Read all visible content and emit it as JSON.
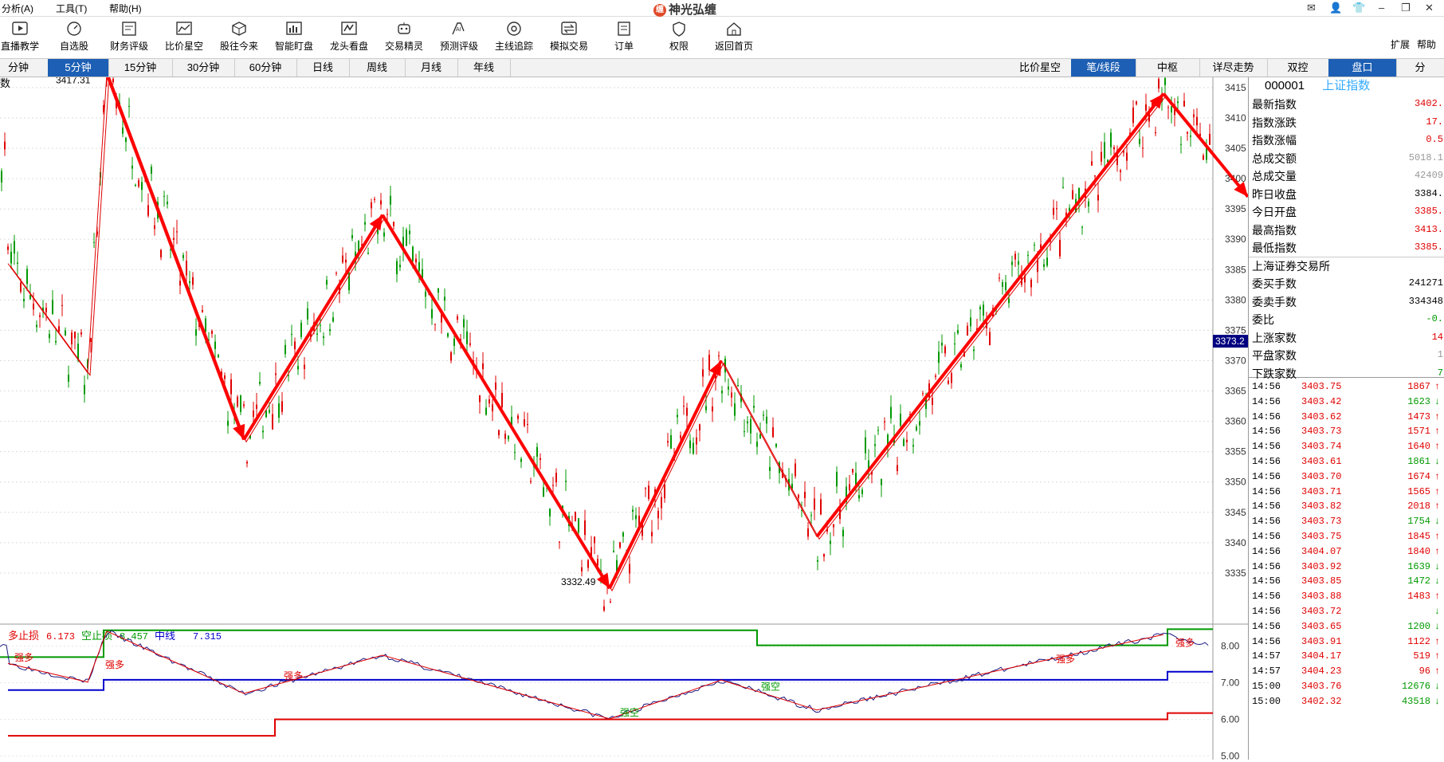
{
  "menu": [
    {
      "label": "分析(A)"
    },
    {
      "label": "工具(T)"
    },
    {
      "label": "帮助(H)"
    }
  ],
  "app_title": "神光弘缠",
  "toolbar": [
    {
      "label": "直播教学",
      "icon": "play-icon"
    },
    {
      "label": "自选股",
      "icon": "gauge-icon"
    },
    {
      "label": "财务评级",
      "icon": "finance-icon"
    },
    {
      "label": "比价星空",
      "icon": "line-chart-icon"
    },
    {
      "label": "股往今来",
      "icon": "cube-icon"
    },
    {
      "label": "智能盯盘",
      "icon": "bar-chart-icon"
    },
    {
      "label": "龙头看盘",
      "icon": "dragon-icon"
    },
    {
      "label": "交易精灵",
      "icon": "robot-icon"
    },
    {
      "label": "预测评级",
      "icon": "ai-icon"
    },
    {
      "label": "主线追踪",
      "icon": "target-icon"
    },
    {
      "label": "模拟交易",
      "icon": "exchange-icon"
    },
    {
      "label": "订单",
      "icon": "order-icon"
    },
    {
      "label": "权限",
      "icon": "shield-icon"
    },
    {
      "label": "返回首页",
      "icon": "home-icon"
    }
  ],
  "toolbar_right": [
    "扩展",
    "帮助"
  ],
  "period_tabs": [
    "分钟",
    "5分钟",
    "15分钟",
    "30分钟",
    "60分钟",
    "日线",
    "周线",
    "月线",
    "年线"
  ],
  "period_active": "5分钟",
  "right_tabs": [
    "比价星空",
    "笔/线段",
    "中枢",
    "详尽走势",
    "双控",
    "盘口",
    "分"
  ],
  "right_tabs_active": [
    "笔/线段",
    "盘口"
  ],
  "chart_label": "数",
  "indicator": {
    "items": [
      {
        "label": "多止损",
        "value": "6.173",
        "color": "#e00000"
      },
      {
        "label": "空止损",
        "value": "8.457",
        "color": "#009900"
      },
      {
        "label": "中线",
        "value": "7.315",
        "color": "#0000cc"
      }
    ],
    "axis": [
      "8.00",
      "7.00",
      "6.00",
      "5.00"
    ],
    "marks": [
      "强多",
      "强多",
      "强多",
      "强空",
      "强空",
      "强多",
      "强多"
    ]
  },
  "chart_data": {
    "type": "candlestick",
    "ylim": [
      3330,
      3418
    ],
    "yticks": [
      3415,
      3410,
      3405,
      3400,
      3395,
      3390,
      3385,
      3380,
      3375,
      3370,
      3365,
      3360,
      3355,
      3350,
      3345,
      3340,
      3335
    ],
    "annotations": [
      {
        "label": "3417.31",
        "value": 3417.31
      },
      {
        "label": "3332.49",
        "value": 3332.49
      }
    ],
    "current_price_label": "3373.2",
    "stroke_zigzag": [
      3386,
      3368,
      3417.31,
      3357,
      3394,
      3332.49,
      3370,
      3341,
      3414
    ],
    "stroke_arrows": [
      {
        "kind": "up",
        "value_from": 3357,
        "value_to": 3394
      },
      {
        "kind": "down",
        "value_from": 3417.31,
        "value_to": 3357
      },
      {
        "kind": "up",
        "value_from": 3332.49,
        "value_to": 3370
      },
      {
        "kind": "down",
        "value_from": 3394,
        "value_to": 3332.49
      },
      {
        "kind": "up",
        "value_from": 3341,
        "value_to": 3414
      },
      {
        "kind": "down",
        "value_from": 3414,
        "value_to": 3397
      },
      {
        "kind": "up",
        "value_from": 3398,
        "value_to": 3410
      },
      {
        "kind": "down",
        "value_from": 3410,
        "value_to": 3388
      }
    ]
  },
  "sidebar": {
    "code": "000001",
    "name": "上证指数",
    "stats": [
      {
        "label": "最新指数",
        "value": "3402.",
        "color": "#e00000"
      },
      {
        "label": "指数涨跌",
        "value": "17.",
        "color": "#e00000"
      },
      {
        "label": "指数涨幅",
        "value": "0.5",
        "color": "#e00000"
      },
      {
        "label": "总成交额",
        "value": "5018.1",
        "color": "#999999"
      },
      {
        "label": "总成交量",
        "value": "42409",
        "color": "#999999"
      },
      {
        "label": "昨日收盘",
        "value": "3384.",
        "color": "#000000"
      },
      {
        "label": "今日开盘",
        "value": "3385.",
        "color": "#e00000"
      },
      {
        "label": "最高指数",
        "value": "3413.",
        "color": "#e00000"
      },
      {
        "label": "最低指数",
        "value": "3385.",
        "color": "#e00000"
      },
      {
        "label": "上海证券交易所",
        "value": "",
        "color": "#000000"
      },
      {
        "label": "委买手数",
        "value": "241271",
        "color": "#000000"
      },
      {
        "label": "委卖手数",
        "value": "334348",
        "color": "#000000"
      },
      {
        "label": "委比",
        "value": "-0.",
        "color": "#009900"
      },
      {
        "label": "上涨家数",
        "value": "14",
        "color": "#e00000"
      },
      {
        "label": "平盘家数",
        "value": "1",
        "color": "#999999"
      },
      {
        "label": "下跌家数",
        "value": "7",
        "color": "#009900"
      }
    ],
    "ticks": [
      {
        "time": "14:56",
        "price": "3403.75",
        "vol": "1867",
        "dir": "up"
      },
      {
        "time": "14:56",
        "price": "3403.42",
        "vol": "1623",
        "dir": "dn"
      },
      {
        "time": "14:56",
        "price": "3403.62",
        "vol": "1473",
        "dir": "up"
      },
      {
        "time": "14:56",
        "price": "3403.73",
        "vol": "1571",
        "dir": "up"
      },
      {
        "time": "14:56",
        "price": "3403.74",
        "vol": "1640",
        "dir": "up"
      },
      {
        "time": "14:56",
        "price": "3403.61",
        "vol": "1861",
        "dir": "dn"
      },
      {
        "time": "14:56",
        "price": "3403.70",
        "vol": "1674",
        "dir": "up"
      },
      {
        "time": "14:56",
        "price": "3403.71",
        "vol": "1565",
        "dir": "up"
      },
      {
        "time": "14:56",
        "price": "3403.82",
        "vol": "2018",
        "dir": "up"
      },
      {
        "time": "14:56",
        "price": "3403.73",
        "vol": "1754",
        "dir": "dn"
      },
      {
        "time": "14:56",
        "price": "3403.75",
        "vol": "1845",
        "dir": "up"
      },
      {
        "time": "14:56",
        "price": "3404.07",
        "vol": "1840",
        "dir": "up"
      },
      {
        "time": "14:56",
        "price": "3403.92",
        "vol": "1639",
        "dir": "dn"
      },
      {
        "time": "14:56",
        "price": "3403.85",
        "vol": "1472",
        "dir": "dn"
      },
      {
        "time": "14:56",
        "price": "3403.88",
        "vol": "1483",
        "dir": "up"
      },
      {
        "time": "14:56",
        "price": "3403.72",
        "vol": "",
        "dir": "dn"
      },
      {
        "time": "14:56",
        "price": "3403.65",
        "vol": "1200",
        "dir": "dn"
      },
      {
        "time": "14:56",
        "price": "3403.91",
        "vol": "1122",
        "dir": "up"
      },
      {
        "time": "14:57",
        "price": "3404.17",
        "vol": "519",
        "dir": "up"
      },
      {
        "time": "14:57",
        "price": "3404.23",
        "vol": "96",
        "dir": "up"
      },
      {
        "time": "15:00",
        "price": "3403.76",
        "vol": "12676",
        "dir": "dn"
      },
      {
        "time": "15:00",
        "price": "3402.32",
        "vol": "43518",
        "dir": "dn"
      }
    ]
  }
}
